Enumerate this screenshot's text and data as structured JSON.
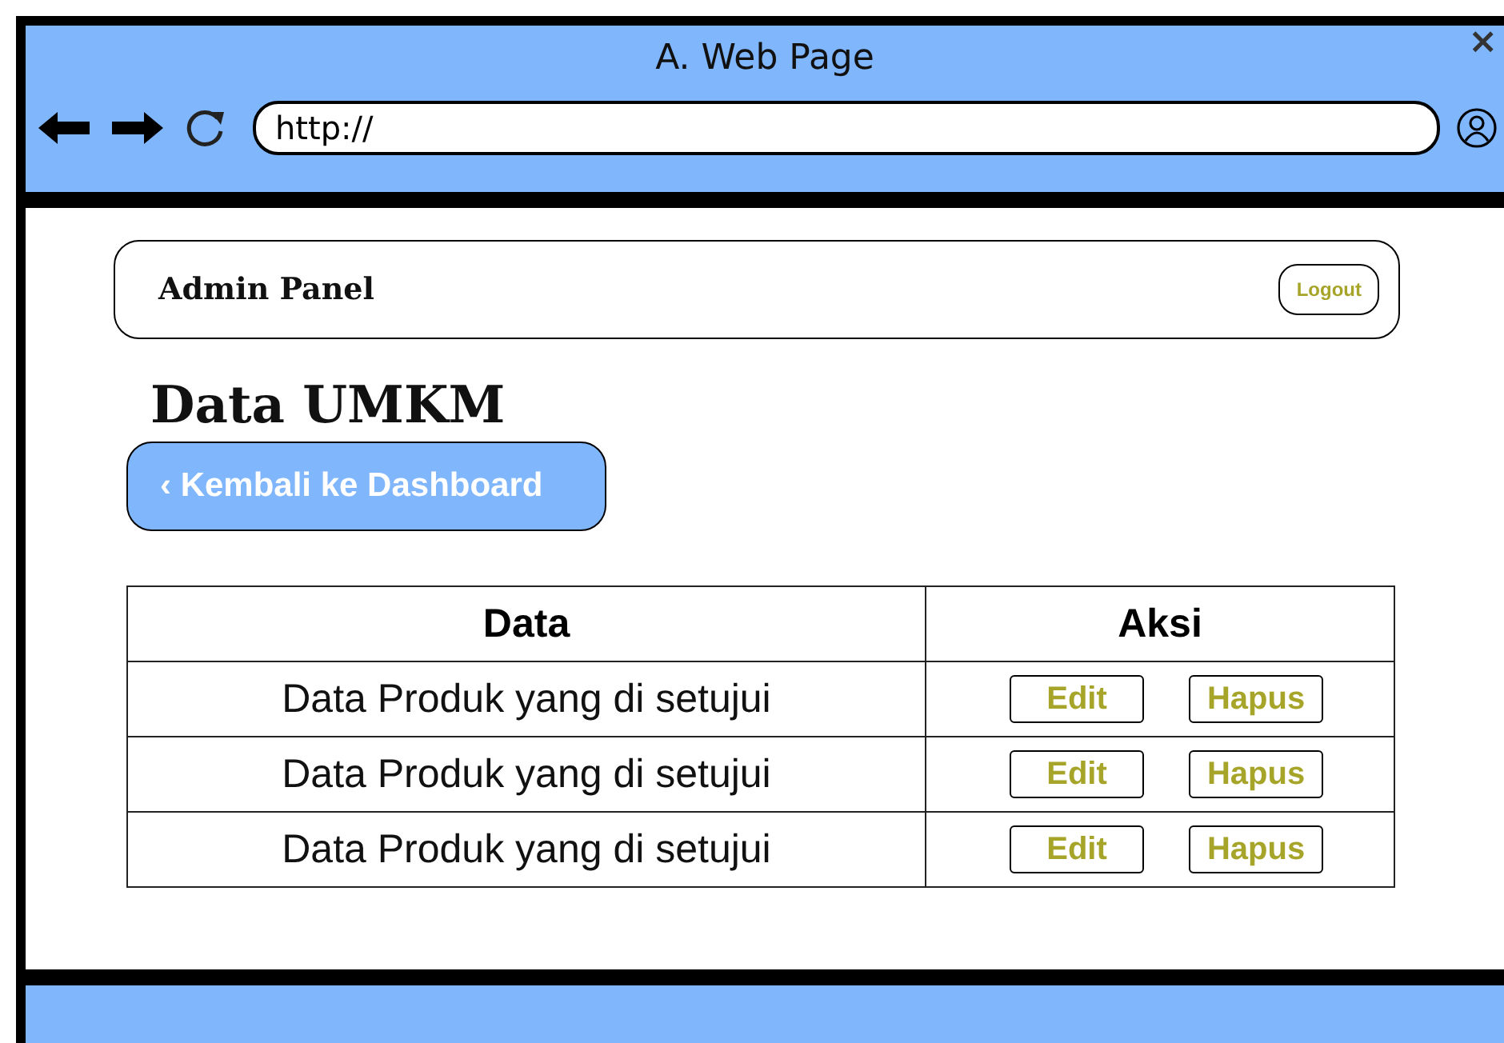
{
  "window": {
    "title": "A. Web Page",
    "close": "×"
  },
  "address_bar": {
    "value": "http://"
  },
  "navbar": {
    "title": "Admin Panel",
    "logout": "Logout"
  },
  "heading": "Data UMKM",
  "back_button": "‹ Kembali ke Dashboard",
  "table": {
    "columns": [
      "Data",
      "Aksi"
    ],
    "rows": [
      {
        "data": "Data Produk yang di setujui",
        "actions": [
          "Edit",
          "Hapus"
        ]
      },
      {
        "data": "Data Produk yang di setujui",
        "actions": [
          "Edit",
          "Hapus"
        ]
      },
      {
        "data": "Data Produk yang di setujui",
        "actions": [
          "Edit",
          "Hapus"
        ]
      }
    ]
  }
}
